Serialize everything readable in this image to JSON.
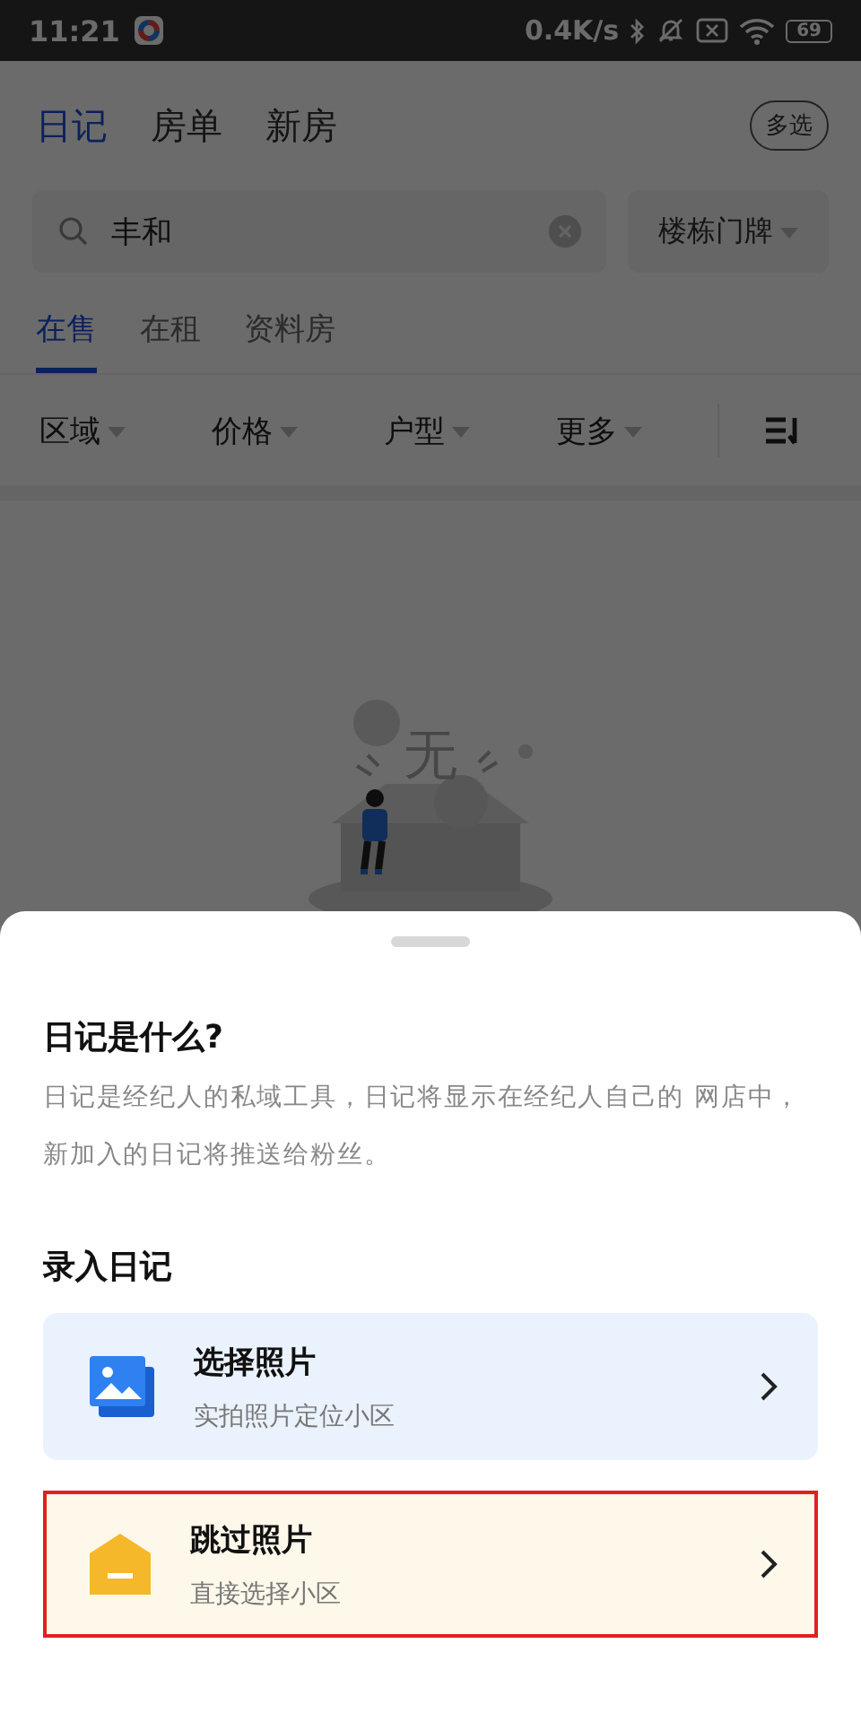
{
  "status_bar": {
    "time": "11:21",
    "net_speed": "0.4K/s",
    "battery": "69"
  },
  "top_tabs": [
    {
      "label": "日记",
      "selected": true
    },
    {
      "label": "房单",
      "selected": false
    },
    {
      "label": "新房",
      "selected": false
    }
  ],
  "multi_select_button": "多选",
  "search": {
    "value": "丰和"
  },
  "building_dropdown": "楼栋门牌",
  "sub_tabs": [
    {
      "label": "在售",
      "selected": true
    },
    {
      "label": "在租",
      "selected": false
    },
    {
      "label": "资料房",
      "selected": false
    }
  ],
  "filters": [
    "区域",
    "价格",
    "户型",
    "更多"
  ],
  "empty_state": {
    "glyph": "无"
  },
  "sheet": {
    "title": "日记是什么?",
    "description": "日记是经纪人的私域工具，日记将显示在经纪人自己的 网店中，新加入的日记将推送给粉丝。",
    "section_title": "录入日记",
    "options": [
      {
        "kind": "photo",
        "title": "选择照片",
        "subtitle": "实拍照片定位小区",
        "highlighted": false
      },
      {
        "kind": "skip",
        "title": "跳过照片",
        "subtitle": "直接选择小区",
        "highlighted": true
      }
    ]
  }
}
